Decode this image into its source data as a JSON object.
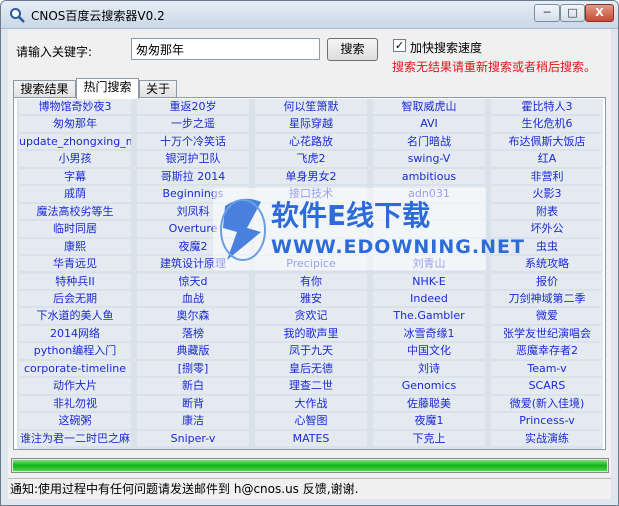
{
  "window": {
    "title": "CNOS百度云搜索器V0.2",
    "min": "─",
    "max": "□",
    "close": "X"
  },
  "search": {
    "label": "请输入关键字:",
    "value": "匆匆那年",
    "button": "搜索",
    "checkbox_label": "加快搜索速度",
    "checkbox_mark": "✓",
    "checked": true
  },
  "hint": "搜索无结果请重新搜索或者稍后搜索。",
  "tabs": [
    "搜索结果",
    "热门搜索",
    "关于"
  ],
  "active_tab": 1,
  "hot": [
    [
      "博物馆奇妙夜3",
      "重返20岁",
      "何以笙箫默",
      "智取威虎山",
      "霍比特人3"
    ],
    [
      "匆匆那年",
      "一步之遥",
      "星际穿越",
      "AVI",
      "生化危机6"
    ],
    [
      "update_zhongxing_m",
      "十万个冷笑话",
      "心花路放",
      "名门暗战",
      "布达佩斯大饭店"
    ],
    [
      "小男孩",
      "银河护卫队",
      "飞虎2",
      "swing-V",
      "红A"
    ],
    [
      "字幕",
      "哥斯拉 2014",
      "单身男女2",
      "ambitious",
      "非营利"
    ],
    [
      "戚荫",
      "Beginnings",
      "接口技术",
      "adn031",
      "火影3"
    ],
    [
      "魔法高校劣等生",
      "刘凤科",
      "",
      "",
      "附表"
    ],
    [
      "临时同居",
      "Overture",
      "",
      "",
      "坏外公"
    ],
    [
      "康熙",
      "夜魔2",
      "",
      "",
      "虫虫"
    ],
    [
      "华青远见",
      "建筑设计原理",
      "Precipice",
      "刘青山",
      "系统攻略"
    ],
    [
      "特种兵II",
      "惊天d",
      "有你",
      "NHK-E",
      "报价"
    ],
    [
      "后会无期",
      "血战",
      "雅安",
      "Indeed",
      "刀剑神域第二季"
    ],
    [
      "下水道的美人鱼",
      "奥尔森",
      "贪欢记",
      "The.Gambler",
      "微爱"
    ],
    [
      "2014网络",
      "落榜",
      "我的歌声里",
      "冰雪奇缘1",
      "张学友世纪演唱会"
    ],
    [
      "python编程入门",
      "典藏版",
      "凤于九天",
      "中国文化",
      "恶魔幸存者2"
    ],
    [
      "corporate-timeline",
      "[捌零]",
      "皇后无德",
      "刘诗",
      "Team-v"
    ],
    [
      "动作大片",
      "新白",
      "理查二世",
      "Genomics",
      "SCARS"
    ],
    [
      "非礼勿视",
      "断背",
      "大作战",
      "佐藤聪美",
      "微爱(新入佳境)"
    ],
    [
      "这碗粥",
      "康洁",
      "心智图",
      "夜魔1",
      "Princess-v"
    ],
    [
      "谁注为君一二时巴之麻",
      "Sniper-v",
      "MATES",
      "下克上",
      "实战演练"
    ]
  ],
  "progress_percent": 100,
  "status": "通知:使用过程中有任何问题请发送邮件到 h@cnos.us 反馈,谢谢.",
  "watermark": {
    "text": "软件E线下载",
    "url": "WWW.EDOWNING.NET"
  },
  "colors": {
    "link": "#1a2ad6",
    "hint": "#e0161a",
    "progress": "#12b312",
    "watermark": "#2c6bd8"
  }
}
